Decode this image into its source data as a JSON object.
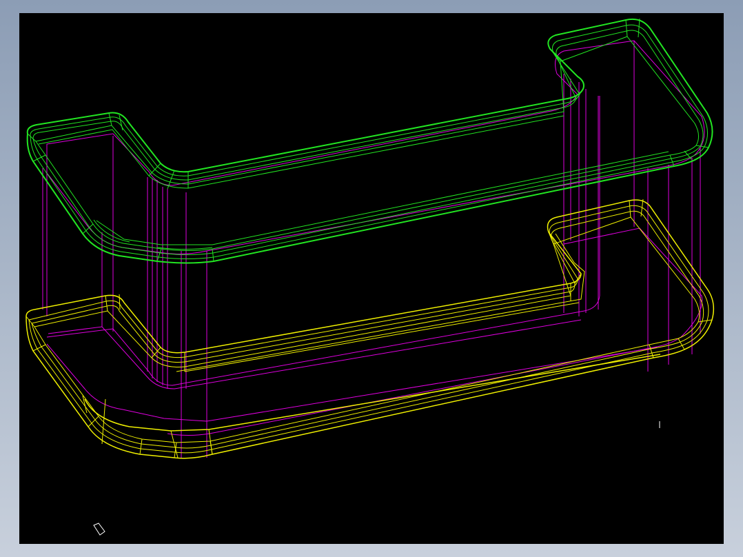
{
  "viewport": {
    "background": "#000000",
    "frame_gradient": [
      "#8c9db5",
      "#c8d0dc"
    ]
  },
  "colors": {
    "upper_rim": "#22e622",
    "lower_rim": "#f0f000",
    "vertical_edges": "#e000e0",
    "ucs_icon": "#ffffff",
    "cursor": "#ffffff"
  },
  "icons": {
    "ucs": "ucs-icon",
    "crosshair": "crosshair-cursor-icon"
  }
}
